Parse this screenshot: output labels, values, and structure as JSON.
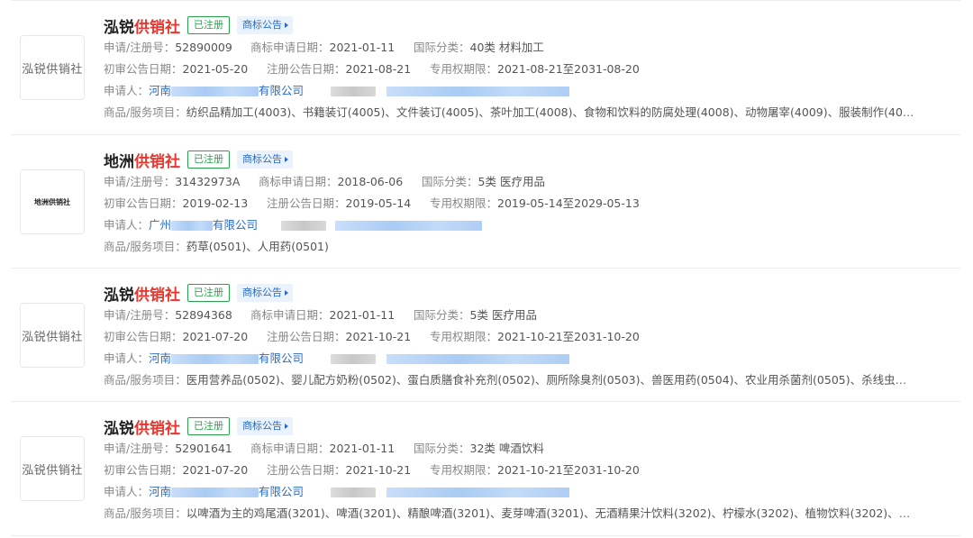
{
  "labels": {
    "reg_no": "申请/注册号：",
    "apply_date": "商标申请日期：",
    "intl_class": "国际分类：",
    "prelim_date": "初审公告日期：",
    "reg_date": "注册公告日期：",
    "valid_period": "专用权期限：",
    "applicant": "申请人：",
    "goods": "商品/服务项目："
  },
  "cards": [
    {
      "logo": "泓锐供销社",
      "name_main": "泓锐",
      "name_highlight": "供销社",
      "status": "已注册",
      "notice": "商标公告",
      "reg_no": "52890009",
      "apply_date": "2021-01-11",
      "intl_class": "40类 材料加工",
      "prelim_date": "2021-05-20",
      "reg_date": "2021-08-21",
      "valid_period": "2021-08-21至2031-08-20",
      "applicant_prefix": "河南",
      "applicant_suffix": "有限公司",
      "goods": "纺织品精加工(4003)、书籍装订(4005)、文件装订(4005)、茶叶加工(4008)、食物和饮料的防腐处理(4008)、动物屠宰(4009)、服装制作(4010)..."
    },
    {
      "logo": "地洲供销社",
      "name_main": "地洲",
      "name_highlight": "供销社",
      "status": "已注册",
      "notice": "商标公告",
      "reg_no": "31432973A",
      "apply_date": "2018-06-06",
      "intl_class": "5类 医疗用品",
      "prelim_date": "2019-02-13",
      "reg_date": "2019-05-14",
      "valid_period": "2019-05-14至2029-05-13",
      "applicant_prefix": "广州",
      "applicant_suffix": "有限公司",
      "goods": "药草(0501)、人用药(0501)"
    },
    {
      "logo": "泓锐供销社",
      "name_main": "泓锐",
      "name_highlight": "供销社",
      "status": "已注册",
      "notice": "商标公告",
      "reg_no": "52894368",
      "apply_date": "2021-01-11",
      "intl_class": "5类 医疗用品",
      "prelim_date": "2021-07-20",
      "reg_date": "2021-10-21",
      "valid_period": "2021-10-21至2031-10-20",
      "applicant_prefix": "河南",
      "applicant_suffix": "有限公司",
      "goods": "医用营养品(0502)、婴儿配方奶粉(0502)、蛋白质膳食补充剂(0502)、厕所除臭剂(0503)、兽医用药(0504)、农业用杀菌剂(0505)、杀线虫剂(0..."
    },
    {
      "logo": "泓锐供销社",
      "name_main": "泓锐",
      "name_highlight": "供销社",
      "status": "已注册",
      "notice": "商标公告",
      "reg_no": "52901641",
      "apply_date": "2021-01-11",
      "intl_class": "32类 啤酒饮料",
      "prelim_date": "2021-07-20",
      "reg_date": "2021-10-21",
      "valid_period": "2021-10-21至2031-10-20",
      "applicant_prefix": "河南",
      "applicant_suffix": "有限公司",
      "goods": "以啤酒为主的鸡尾酒(3201)、啤酒(3201)、精酿啤酒(3201)、麦芽啤酒(3201)、无酒精果汁饮料(3202)、柠檬水(3202)、植物饮料(3202)、软饮..."
    }
  ]
}
